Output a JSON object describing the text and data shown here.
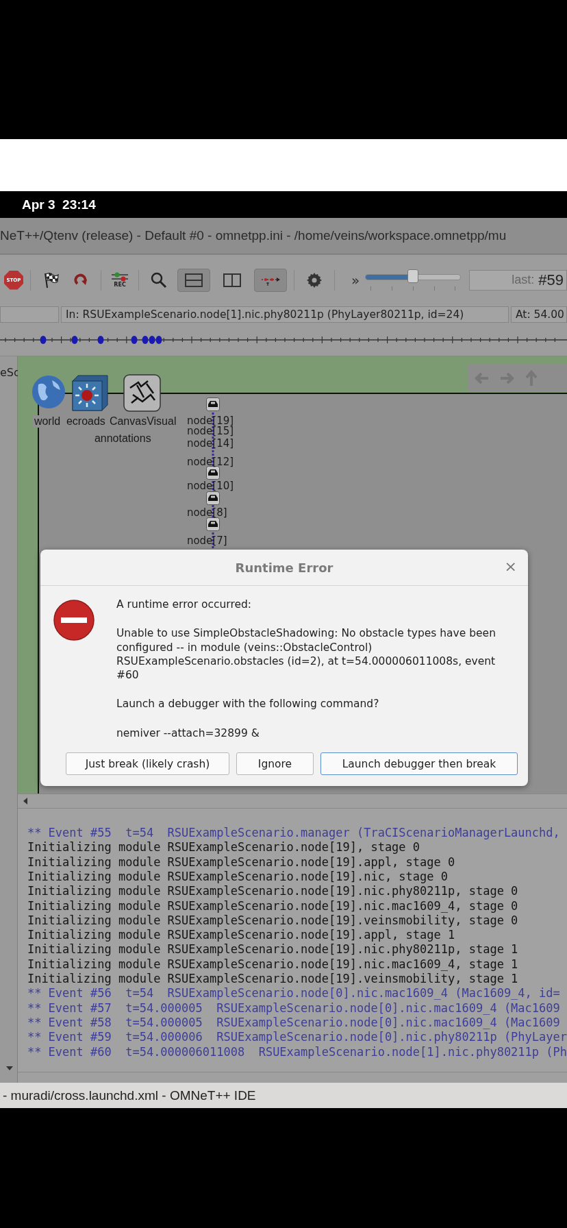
{
  "status_bar": {
    "time": "Apr 3  23:14"
  },
  "window": {
    "title": "NeT++/Qtenv (release) - Default #0 - omnetpp.ini - /home/veins/workspace.omnetpp/mu"
  },
  "toolbar": {
    "items": [
      {
        "kind": "stop",
        "label": "STOP"
      },
      {
        "kind": "separator"
      },
      {
        "kind": "flag"
      },
      {
        "kind": "redo"
      },
      {
        "kind": "separator"
      },
      {
        "kind": "rec",
        "label": "REC"
      },
      {
        "kind": "separator"
      },
      {
        "kind": "search"
      },
      {
        "kind": "layout-rows",
        "selected": true
      },
      {
        "kind": "layout-cols",
        "selected": false
      },
      {
        "kind": "timeline",
        "selected": true
      },
      {
        "kind": "separator"
      },
      {
        "kind": "gear"
      },
      {
        "kind": "separator"
      },
      {
        "kind": "more",
        "label": "»"
      }
    ],
    "speed": {
      "level": 0.5
    },
    "event_field": {
      "label": "last:",
      "value": "#59"
    }
  },
  "info_bar": {
    "module": "In: RSUExampleScenario.node[1].nic.phy80211p (PhyLayer80211p, id=24)",
    "time": "At: 54.00"
  },
  "canvas": {
    "side_label": "eSc",
    "modules": [
      {
        "kind": "globe",
        "label": "world"
      },
      {
        "kind": "cube",
        "label": "ecroads"
      },
      {
        "kind": "puzzle",
        "label": "CanvasVisual"
      }
    ],
    "annotation_label": "annotations",
    "nodes": [
      "node[19]",
      "node[15]",
      "node[14]",
      "node[12]",
      "node[10]",
      "node[8]",
      "node[7]"
    ]
  },
  "dialog": {
    "title": "Runtime Error",
    "close": "×",
    "heading": "A runtime error occurred:",
    "message": "Unable to use SimpleObstacleShadowing: No obstacle types have been configured -- in module (veins::ObstacleControl) RSUExampleScenario.obstacles (id=2), at t=54.000006011008s, event #60",
    "question": "Launch a debugger with the following command?",
    "command": "nemiver --attach=32899 &",
    "buttons": [
      {
        "label": "Just break (likely crash)",
        "selected": false
      },
      {
        "label": "Ignore",
        "selected": false
      },
      {
        "label": "Launch debugger then break",
        "selected": true
      }
    ]
  },
  "log": {
    "lines": [
      {
        "kind": "event",
        "text": "** Event #55  t=54  RSUExampleScenario.manager (TraCIScenarioManagerLaunchd,"
      },
      {
        "kind": "info",
        "text": "Initializing module RSUExampleScenario.node[19], stage 0"
      },
      {
        "kind": "info",
        "text": "Initializing module RSUExampleScenario.node[19].appl, stage 0"
      },
      {
        "kind": "info",
        "text": "Initializing module RSUExampleScenario.node[19].nic, stage 0"
      },
      {
        "kind": "info",
        "text": "Initializing module RSUExampleScenario.node[19].nic.phy80211p, stage 0"
      },
      {
        "kind": "info",
        "text": "Initializing module RSUExampleScenario.node[19].nic.mac1609_4, stage 0"
      },
      {
        "kind": "info",
        "text": "Initializing module RSUExampleScenario.node[19].veinsmobility, stage 0"
      },
      {
        "kind": "info",
        "text": "Initializing module RSUExampleScenario.node[19].appl, stage 1"
      },
      {
        "kind": "info",
        "text": "Initializing module RSUExampleScenario.node[19].nic.phy80211p, stage 1"
      },
      {
        "kind": "info",
        "text": "Initializing module RSUExampleScenario.node[19].nic.mac1609_4, stage 1"
      },
      {
        "kind": "info",
        "text": "Initializing module RSUExampleScenario.node[19].veinsmobility, stage 1"
      },
      {
        "kind": "event",
        "text": "** Event #56  t=54  RSUExampleScenario.node[0].nic.mac1609_4 (Mac1609_4, id="
      },
      {
        "kind": "event",
        "text": "** Event #57  t=54.000005  RSUExampleScenario.node[0].nic.mac1609_4 (Mac1609"
      },
      {
        "kind": "event",
        "text": "** Event #58  t=54.000005  RSUExampleScenario.node[0].nic.mac1609_4 (Mac1609"
      },
      {
        "kind": "event",
        "text": "** Event #59  t=54.000006  RSUExampleScenario.node[0].nic.phy80211p (PhyLayer"
      },
      {
        "kind": "event",
        "text": "** Event #60  t=54.000006011008  RSUExampleScenario.node[1].nic.phy80211p (Ph"
      }
    ]
  },
  "taskbar": {
    "title": "- muradi/cross.launchd.xml - OMNeT++ IDE"
  }
}
